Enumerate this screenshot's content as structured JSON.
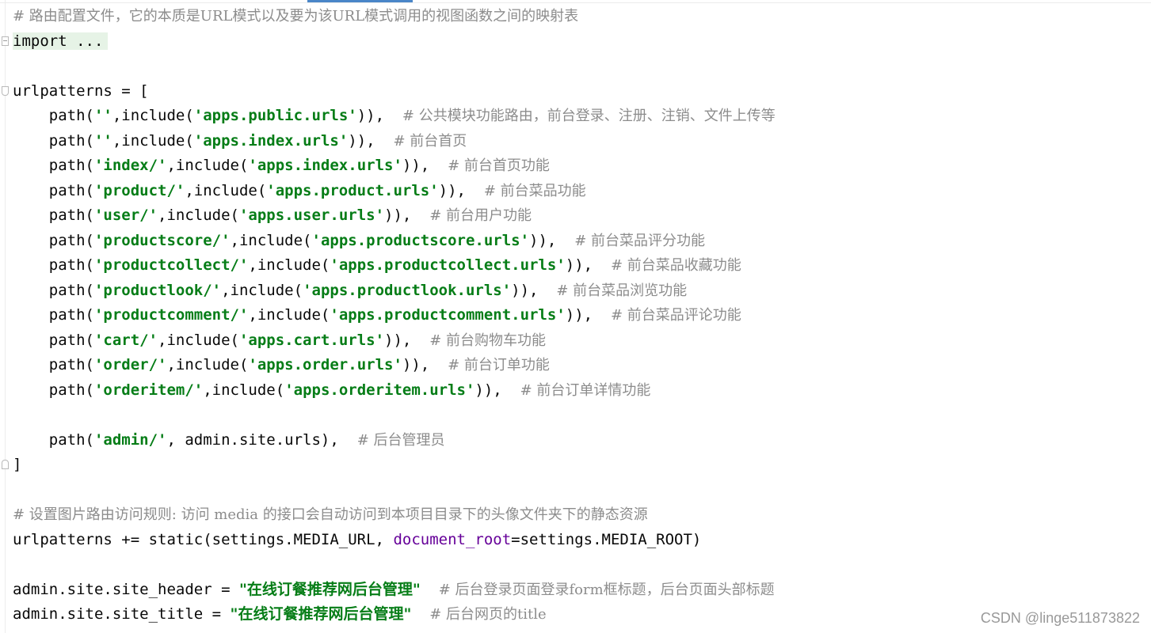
{
  "editor": {
    "lines": [
      {
        "segments": [
          {
            "text": "# 路由配置文件，它的本质是URL模式以及要为该URL模式调用的视图函数之间的映射表",
            "cls": "c-comment"
          }
        ]
      },
      {
        "fold": "box",
        "segments": [
          {
            "text": "import ...",
            "cls": "folded"
          }
        ]
      },
      {
        "segments": []
      },
      {
        "fold": "top",
        "segments": [
          {
            "text": "urlpatterns = [",
            "cls": ""
          }
        ]
      },
      {
        "segments": [
          {
            "text": "    path(",
            "cls": ""
          },
          {
            "text": "''",
            "cls": "c-str"
          },
          {
            "text": ",include(",
            "cls": ""
          },
          {
            "text": "'apps.public.urls'",
            "cls": "c-str"
          },
          {
            "text": ")),  ",
            "cls": ""
          },
          {
            "text": "# 公共模块功能路由，前台登录、注册、注销、文件上传等",
            "cls": "c-comment"
          }
        ]
      },
      {
        "segments": [
          {
            "text": "    path(",
            "cls": ""
          },
          {
            "text": "''",
            "cls": "c-str"
          },
          {
            "text": ",include(",
            "cls": ""
          },
          {
            "text": "'apps.index.urls'",
            "cls": "c-str"
          },
          {
            "text": ")),  ",
            "cls": ""
          },
          {
            "text": "# 前台首页",
            "cls": "c-comment"
          }
        ]
      },
      {
        "segments": [
          {
            "text": "    path(",
            "cls": ""
          },
          {
            "text": "'index/'",
            "cls": "c-str"
          },
          {
            "text": ",include(",
            "cls": ""
          },
          {
            "text": "'apps.index.urls'",
            "cls": "c-str"
          },
          {
            "text": ")),  ",
            "cls": ""
          },
          {
            "text": "# 前台首页功能",
            "cls": "c-comment"
          }
        ]
      },
      {
        "segments": [
          {
            "text": "    path(",
            "cls": ""
          },
          {
            "text": "'product/'",
            "cls": "c-str"
          },
          {
            "text": ",include(",
            "cls": ""
          },
          {
            "text": "'apps.product.urls'",
            "cls": "c-str"
          },
          {
            "text": ")),  ",
            "cls": ""
          },
          {
            "text": "# 前台菜品功能",
            "cls": "c-comment"
          }
        ]
      },
      {
        "segments": [
          {
            "text": "    path(",
            "cls": ""
          },
          {
            "text": "'user/'",
            "cls": "c-str"
          },
          {
            "text": ",include(",
            "cls": ""
          },
          {
            "text": "'apps.user.urls'",
            "cls": "c-str"
          },
          {
            "text": ")),  ",
            "cls": ""
          },
          {
            "text": "# 前台用户功能",
            "cls": "c-comment"
          }
        ]
      },
      {
        "segments": [
          {
            "text": "    path(",
            "cls": ""
          },
          {
            "text": "'productscore/'",
            "cls": "c-str"
          },
          {
            "text": ",include(",
            "cls": ""
          },
          {
            "text": "'apps.productscore.urls'",
            "cls": "c-str"
          },
          {
            "text": ")),  ",
            "cls": ""
          },
          {
            "text": "# 前台菜品评分功能",
            "cls": "c-comment"
          }
        ]
      },
      {
        "segments": [
          {
            "text": "    path(",
            "cls": ""
          },
          {
            "text": "'productcollect/'",
            "cls": "c-str"
          },
          {
            "text": ",include(",
            "cls": ""
          },
          {
            "text": "'apps.productcollect.urls'",
            "cls": "c-str"
          },
          {
            "text": ")),  ",
            "cls": ""
          },
          {
            "text": "# 前台菜品收藏功能",
            "cls": "c-comment"
          }
        ]
      },
      {
        "segments": [
          {
            "text": "    path(",
            "cls": ""
          },
          {
            "text": "'productlook/'",
            "cls": "c-str"
          },
          {
            "text": ",include(",
            "cls": ""
          },
          {
            "text": "'apps.productlook.urls'",
            "cls": "c-str"
          },
          {
            "text": ")),  ",
            "cls": ""
          },
          {
            "text": "# 前台菜品浏览功能",
            "cls": "c-comment"
          }
        ]
      },
      {
        "segments": [
          {
            "text": "    path(",
            "cls": ""
          },
          {
            "text": "'productcomment/'",
            "cls": "c-str"
          },
          {
            "text": ",include(",
            "cls": ""
          },
          {
            "text": "'apps.productcomment.urls'",
            "cls": "c-str"
          },
          {
            "text": ")),  ",
            "cls": ""
          },
          {
            "text": "# 前台菜品评论功能",
            "cls": "c-comment"
          }
        ]
      },
      {
        "segments": [
          {
            "text": "    path(",
            "cls": ""
          },
          {
            "text": "'cart/'",
            "cls": "c-str"
          },
          {
            "text": ",include(",
            "cls": ""
          },
          {
            "text": "'apps.cart.urls'",
            "cls": "c-str"
          },
          {
            "text": ")),  ",
            "cls": ""
          },
          {
            "text": "# 前台购物车功能",
            "cls": "c-comment"
          }
        ]
      },
      {
        "segments": [
          {
            "text": "    path(",
            "cls": ""
          },
          {
            "text": "'order/'",
            "cls": "c-str"
          },
          {
            "text": ",include(",
            "cls": ""
          },
          {
            "text": "'apps.order.urls'",
            "cls": "c-str"
          },
          {
            "text": ")),  ",
            "cls": ""
          },
          {
            "text": "# 前台订单功能",
            "cls": "c-comment"
          }
        ]
      },
      {
        "segments": [
          {
            "text": "    path(",
            "cls": ""
          },
          {
            "text": "'orderitem/'",
            "cls": "c-str"
          },
          {
            "text": ",include(",
            "cls": ""
          },
          {
            "text": "'apps.orderitem.urls'",
            "cls": "c-str"
          },
          {
            "text": ")),  ",
            "cls": ""
          },
          {
            "text": "# 前台订单详情功能",
            "cls": "c-comment"
          }
        ]
      },
      {
        "segments": []
      },
      {
        "segments": [
          {
            "text": "    path(",
            "cls": ""
          },
          {
            "text": "'admin/'",
            "cls": "c-str"
          },
          {
            "text": ", admin.site.urls),  ",
            "cls": ""
          },
          {
            "text": "# 后台管理员",
            "cls": "c-comment"
          }
        ]
      },
      {
        "fold": "bottom",
        "segments": [
          {
            "text": "]",
            "cls": ""
          }
        ]
      },
      {
        "segments": []
      },
      {
        "segments": [
          {
            "text": "# 设置图片路由访问规则: 访问 media 的接口会自动访问到本项目目录下的头像文件夹下的静态资源",
            "cls": "c-comment"
          }
        ]
      },
      {
        "segments": [
          {
            "text": "urlpatterns += static(settings.MEDIA_URL, ",
            "cls": ""
          },
          {
            "text": "document_root",
            "cls": "c-param"
          },
          {
            "text": "=settings.MEDIA_ROOT)",
            "cls": ""
          }
        ]
      },
      {
        "segments": []
      },
      {
        "segments": [
          {
            "text": "admin.site.site_header = ",
            "cls": ""
          },
          {
            "text": "\"在线订餐推荐网后台管理\"",
            "cls": "c-str-cn"
          },
          {
            "text": "  ",
            "cls": ""
          },
          {
            "text": "# 后台登录页面登录form框标题，后台页面头部标题",
            "cls": "c-comment"
          }
        ]
      },
      {
        "segments": [
          {
            "text": "admin.site.site_title = ",
            "cls": ""
          },
          {
            "text": "\"在线订餐推荐网后台管理\"",
            "cls": "c-str-cn"
          },
          {
            "text": "  ",
            "cls": ""
          },
          {
            "text": "# 后台网页的title",
            "cls": "c-comment"
          }
        ]
      }
    ]
  },
  "watermark": "CSDN @linge511873822"
}
